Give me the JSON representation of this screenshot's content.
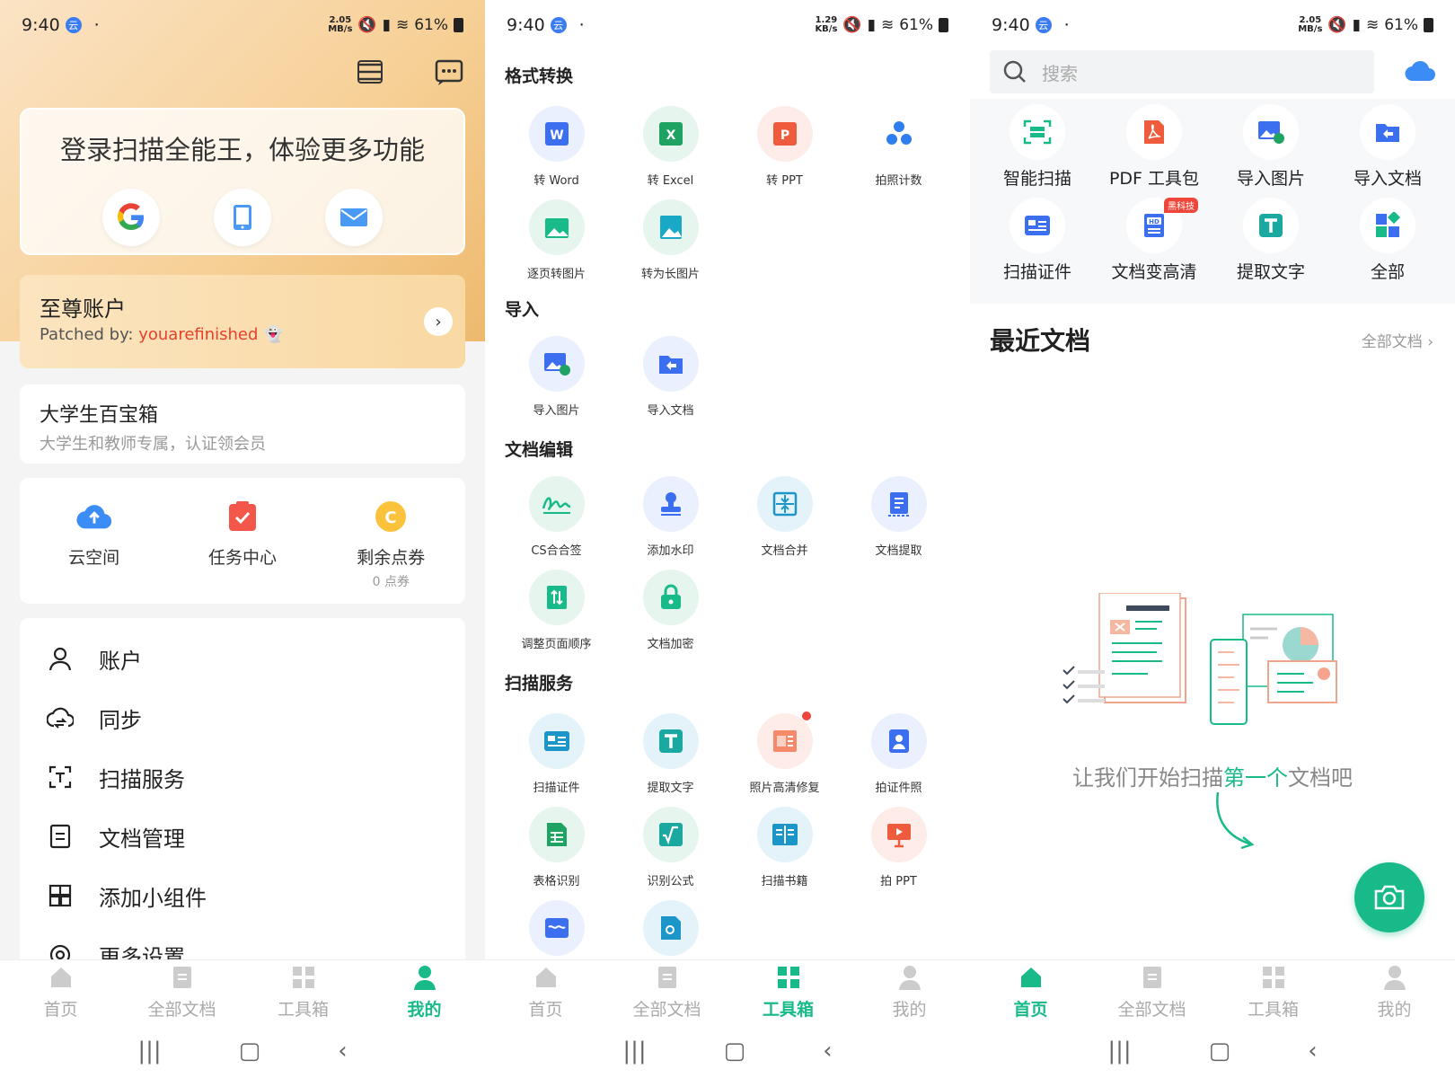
{
  "colors": {
    "accent": "#19ba8a",
    "gold": "#f6cf94",
    "red": "#f0453a",
    "blue": "#3b7cf2"
  },
  "status": [
    {
      "time": "9:40",
      "speed_top": "2.05",
      "speed_bottom": "MB/s",
      "battery": "61%"
    },
    {
      "time": "9:40",
      "speed_top": "1.29",
      "speed_bottom": "KB/s",
      "battery": "61%"
    },
    {
      "time": "9:40",
      "speed_top": "2.05",
      "speed_bottom": "MB/s",
      "battery": "61%"
    }
  ],
  "nav": {
    "home": "首页",
    "all_docs": "全部文档",
    "toolbox": "工具箱",
    "mine": "我的"
  },
  "profile": {
    "login_title": "登录扫描全能王，体验更多功能",
    "login_icons": [
      "google-icon",
      "phone-icon",
      "mail-icon"
    ],
    "premium_title": "至尊账户",
    "premium_sub_prefix": "Patched by: ",
    "premium_sub_name": "youarefinished",
    "student_title": "大学生百宝箱",
    "student_sub": "大学生和教师专属，认证领会员",
    "quick": [
      {
        "label": "云空间",
        "sub": ""
      },
      {
        "label": "任务中心",
        "sub": ""
      },
      {
        "label": "剩余点券",
        "sub": "0 点券"
      }
    ],
    "menu": [
      "账户",
      "同步",
      "扫描服务",
      "文档管理",
      "添加小组件",
      "更多设置"
    ]
  },
  "toolbox": {
    "sections": [
      "格式转换",
      "导入",
      "文档编辑",
      "扫描服务"
    ],
    "format": [
      "转 Word",
      "转 Excel",
      "转 PPT",
      "拍照计数",
      "逐页转图片",
      "转为长图片"
    ],
    "import": [
      "导入图片",
      "导入文档"
    ],
    "edit": [
      "CS合合签",
      "添加水印",
      "文档合并",
      "文档提取",
      "调整页面顺序",
      "文档加密"
    ],
    "scan": [
      "扫描证件",
      "提取文字",
      "照片高清修复",
      "拍证件照",
      "表格识别",
      "识别公式",
      "扫描书籍",
      "拍 PPT"
    ]
  },
  "home": {
    "search_placeholder": "搜索",
    "tools": [
      "智能扫描",
      "PDF 工具包",
      "导入图片",
      "导入文档",
      "扫描证件",
      "文档变高清",
      "提取文字",
      "全部"
    ],
    "hd_badge": "黑科技",
    "recent_title": "最近文档",
    "recent_all": "全部文档 ›",
    "empty_pre": "让我们开始扫描",
    "empty_mid": "第一个",
    "empty_post": "文档吧"
  }
}
